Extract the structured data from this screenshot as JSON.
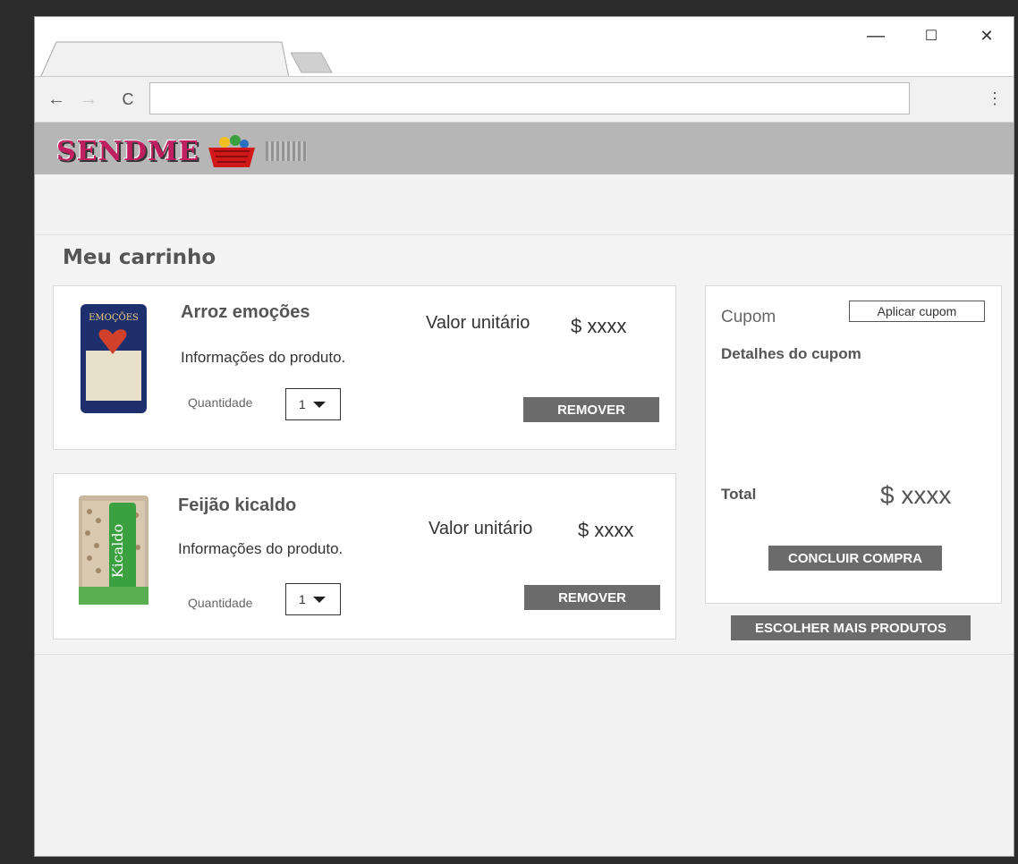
{
  "browser": {
    "window_controls": {
      "minimize": "—",
      "maximize": "☐",
      "close": "✕"
    },
    "nav": {
      "back": "←",
      "forward": "→",
      "reload": "C",
      "menu": "⋮"
    },
    "url_value": ""
  },
  "site": {
    "logo_text": "SENDME"
  },
  "cart": {
    "title": "Meu carrinho",
    "items": [
      {
        "name": "Arroz emoções",
        "info": "Informações do produto.",
        "quantity_label": "Quantidade",
        "quantity": "1",
        "unit_label": "Valor unitário",
        "unit_price": "$ xxxx",
        "remove_label": "REMOVER",
        "image_label": "EMOÇÕES"
      },
      {
        "name": "Feijão kicaldo",
        "info": "Informações do produto.",
        "quantity_label": "Quantidade",
        "quantity": "1",
        "unit_label": "Valor unitário",
        "unit_price": "$ xxxx",
        "remove_label": "REMOVER",
        "image_label": "Kicaldo"
      }
    ]
  },
  "summary": {
    "coupon_label": "Cupom",
    "apply_coupon_label": "Aplicar cupom",
    "coupon_details_label": "Detalhes do cupom",
    "total_label": "Total",
    "total_value": "$ xxxx",
    "checkout_label": "CONCLUIR COMPRA",
    "more_products_label": "ESCOLHER MAIS PRODUTOS"
  },
  "colors": {
    "button_bg": "#6b6b6b",
    "site_header": "#b6b6b6",
    "page_bg": "#f4f4f4"
  }
}
